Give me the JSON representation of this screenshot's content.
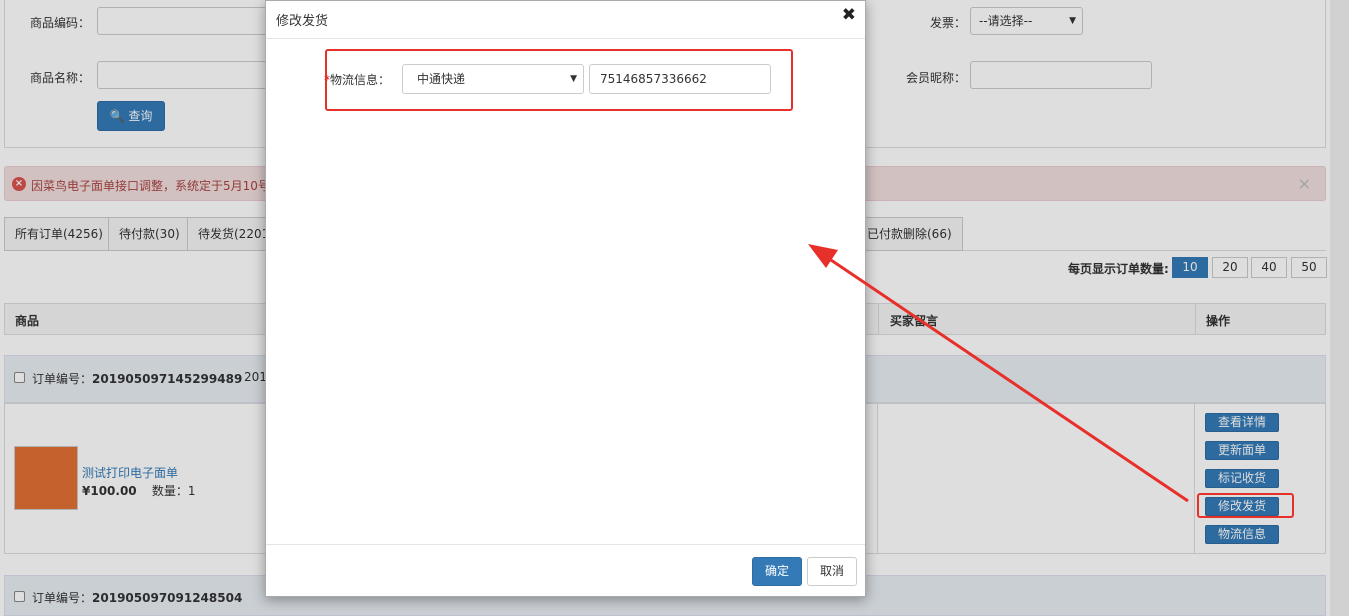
{
  "search": {
    "product_code_label": "商品编码：",
    "product_name_label": "商品名称：",
    "query_button": "查询",
    "invoice_label": "发票：",
    "invoice_value": "--请选择--",
    "nickname_label": "会员昵称："
  },
  "alert": {
    "text": "因菜鸟电子面单接口调整，系统定于5月10号",
    "close": "×"
  },
  "tabs": [
    {
      "label": "所有订单(4256)"
    },
    {
      "label": "待付款(30)"
    },
    {
      "label": "待发货(2201"
    },
    {
      "label": "已付款删除(66)"
    }
  ],
  "per_page": {
    "label": "每页显示订单数量:",
    "options": [
      "10",
      "20",
      "40",
      "50"
    ],
    "active": "10"
  },
  "table_header": {
    "product": "商品",
    "buyer_message": "买家留言",
    "actions": "操作"
  },
  "order1": {
    "label": "订单编号：",
    "number": "201905097145299489",
    "date_partial": "201",
    "product_name": "测试打印电子面单",
    "price": "¥100.00",
    "quantity": "数量：1",
    "actions": [
      "查看详情",
      "更新面单",
      "标记收货",
      "修改发货",
      "物流信息"
    ]
  },
  "order2": {
    "label": "订单编号：",
    "number": "201905097091248504"
  },
  "modal": {
    "title": "修改发货",
    "close": "✖",
    "shipping_label": "物流信息：",
    "required_mark": "*",
    "carrier": "中通快递",
    "tracking_number": "75146857336662",
    "confirm": "确定",
    "cancel": "取消"
  },
  "colors": {
    "primary": "#337ab7",
    "annotation_red": "#e8302a",
    "alert_bg": "#f2dede",
    "alert_text": "#a94442"
  }
}
